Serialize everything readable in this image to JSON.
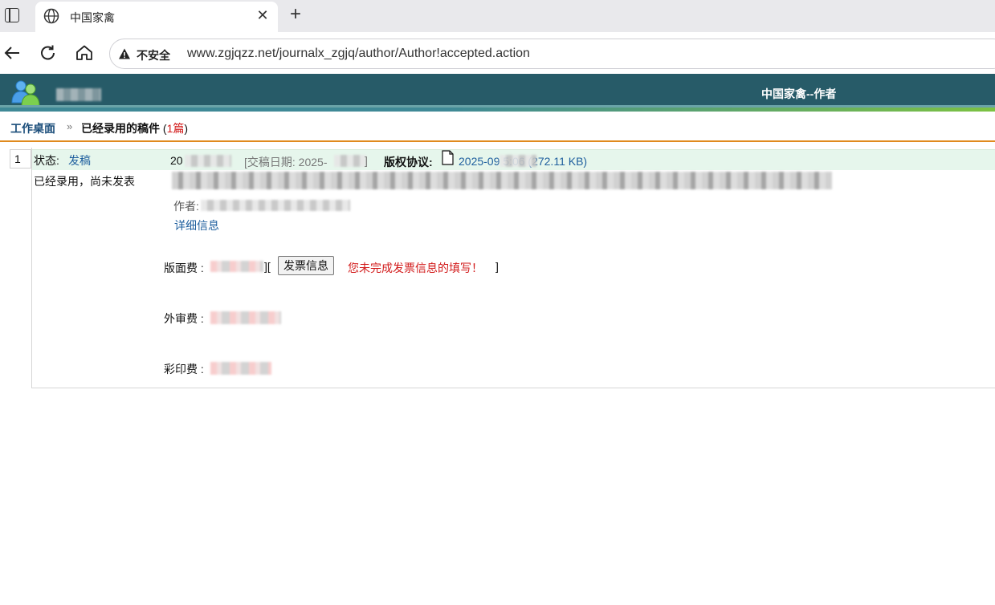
{
  "browser": {
    "tab_title": "中国家禽",
    "tab_close": "✕",
    "new_tab": "+",
    "insecure_label": "不安全",
    "url": "www.zgjqzz.net/journalx_zgjq/author/Author!accepted.action"
  },
  "site": {
    "header_title": "中国家禽--作者"
  },
  "breadcrumb": {
    "home": "工作桌面",
    "separator": "»",
    "current": "已经录用的稿件",
    "count_open": " (",
    "count": "1篇",
    "count_close": ")"
  },
  "manuscript": {
    "index": "1",
    "status_label": "状态:",
    "status_link": "发稿",
    "state_text": "已经录用，尚未发表",
    "id_prefix": "20",
    "submit_date": "[交稿日期: 2025-",
    "submit_date_close": "]",
    "copyright_label": "版权协议:",
    "copyright_file": "2025-09      5:06 (272.11 KB)",
    "author_label": "作者:",
    "detail_link": "详细信息",
    "page_fee_label": "版面费 :",
    "bracket_open": "][",
    "invoice_button": "发票信息",
    "invoice_warning": "您未完成发票信息的填写！",
    "bracket_close": "]",
    "review_fee_label": "外审费 :",
    "print_fee_label": "彩印费 :"
  },
  "colors": {
    "header_bg": "#275b68",
    "link": "#1f5f9e",
    "warning": "#d21a1a",
    "divider": "#e08a1e",
    "row_highlight": "#e6f6ec"
  }
}
